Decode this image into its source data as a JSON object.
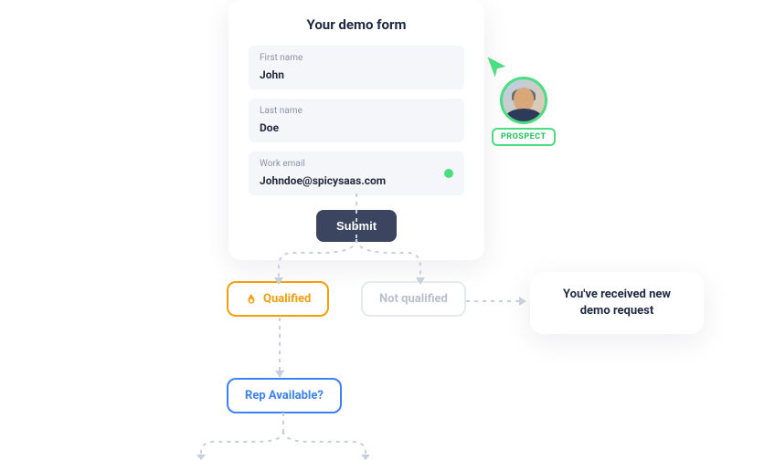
{
  "form": {
    "title": "Your demo form",
    "first_name": {
      "label": "First name",
      "value": "John"
    },
    "last_name": {
      "label": "Last name",
      "value": "Doe"
    },
    "work_email": {
      "label": "Work email",
      "value": "Johndoe@spicysaas.com"
    },
    "submit_label": "Submit"
  },
  "prospect": {
    "badge": "PROSPECT"
  },
  "flow": {
    "qualified_label": "Qualified",
    "not_qualified_label": "Not qualified",
    "rep_available_label": "Rep Available?"
  },
  "notification": {
    "text": "You've received new demo request"
  }
}
